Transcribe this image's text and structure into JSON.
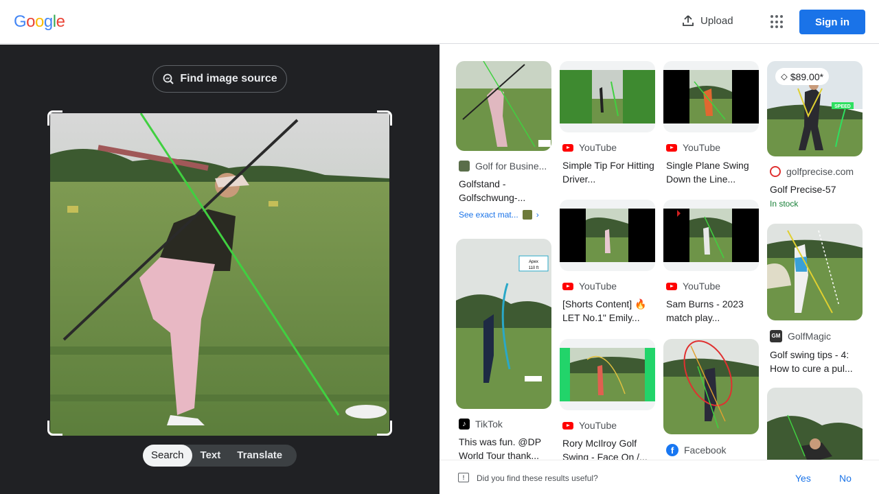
{
  "header": {
    "logo": "Google",
    "upload_label": "Upload",
    "signin_label": "Sign in"
  },
  "lens": {
    "find_source_label": "Find image source",
    "modes": [
      "Search",
      "Text",
      "Translate"
    ],
    "active_mode": "Search"
  },
  "results": [
    {
      "source": "Golf for Busine...",
      "title": "Golfstand - Golfschwung-...",
      "see_exact": "See exact mat..."
    },
    {
      "source": "YouTube",
      "title": "Simple Tip For Hitting Driver..."
    },
    {
      "source": "YouTube",
      "title": "Single Plane Swing Down the Line..."
    },
    {
      "source": "golfprecise.com",
      "title": "Golf Precise-57",
      "price": "$89.00*",
      "stock": "In stock",
      "badge_text": "SPEED"
    },
    {
      "source": "YouTube",
      "title": "[Shorts Content] 🔥 LET No.1\" Emily..."
    },
    {
      "source": "YouTube",
      "title": "Sam Burns - 2023 match play..."
    },
    {
      "source": "GolfMagic",
      "title": "Golf swing tips - 4: How to cure a pul..."
    },
    {
      "source": "TikTok",
      "title": "This was fun. @DP World Tour thank...",
      "apex_label": "Apex",
      "apex_value": "110 ft"
    },
    {
      "source": "YouTube",
      "title": "Rory McIlroy Golf Swing - Face On /..."
    },
    {
      "source": "Facebook",
      "title": ""
    },
    {
      "source": "",
      "title": ""
    }
  ],
  "feedback": {
    "question": "Did you find these results useful?",
    "yes": "Yes",
    "no": "No"
  },
  "colors": {
    "accent": "#1a73e8",
    "dark_bg": "#202124",
    "youtube_red": "#ff0000",
    "stock_green": "#188038"
  }
}
